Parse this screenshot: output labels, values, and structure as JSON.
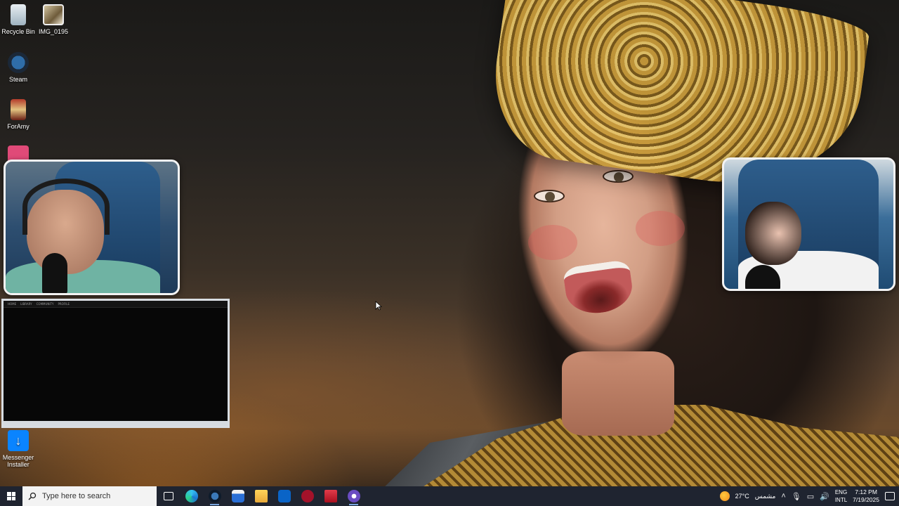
{
  "desktop": {
    "icons": [
      {
        "label": "Recycle Bin",
        "icon": "recycle-bin-icon"
      },
      {
        "label": "IMG_0195",
        "icon": "image-file-icon"
      },
      {
        "label": "Steam",
        "icon": "steam-icon"
      },
      {
        "label": "ForAmy",
        "icon": "picture-file-icon"
      },
      {
        "label": "",
        "icon": "app-shortcut-icon"
      },
      {
        "label": "Messenger Installer",
        "icon": "messenger-installer-icon"
      }
    ]
  },
  "mini_screen": {
    "menu": [
      "HOME",
      "LIBRARY",
      "COMMUNITY",
      "PROFILE"
    ]
  },
  "taskbar": {
    "search_placeholder": "Type here to search",
    "apps": [
      {
        "name": "task-view-icon"
      },
      {
        "name": "edge-icon"
      },
      {
        "name": "steam-taskbar-icon",
        "active": true
      },
      {
        "name": "store-icon"
      },
      {
        "name": "file-explorer-icon"
      },
      {
        "name": "outlook-icon"
      },
      {
        "name": "valorant-icon"
      },
      {
        "name": "voicemod-icon"
      },
      {
        "name": "obs-icon",
        "active": true
      }
    ],
    "weather": {
      "temp": "27°C",
      "condition": "مشمس"
    },
    "language": {
      "line1": "ENG",
      "line2": "INTL"
    },
    "clock": {
      "time": "7:12 PM",
      "date": "7/19/2025"
    }
  },
  "colors": {
    "taskbar_bg": "#1f2430",
    "webcam_border": "#f3f3f3"
  }
}
